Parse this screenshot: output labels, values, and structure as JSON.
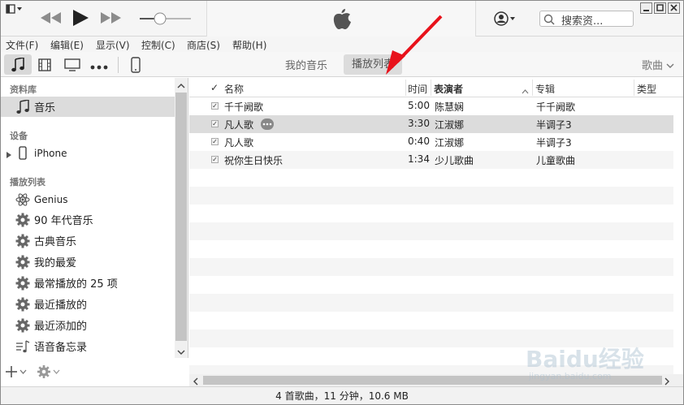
{
  "search": {
    "placeholder": "搜索资..."
  },
  "menu": [
    "文件(F)",
    "编辑(E)",
    "显示(V)",
    "控制(C)",
    "商店(S)",
    "帮助(H)"
  ],
  "toolbar": {
    "my_music": "我的音乐",
    "playlists": "播放列表",
    "view_label": "歌曲"
  },
  "sidebar": {
    "library_header": "资料库",
    "music": "音乐",
    "devices_header": "设备",
    "iphone": "iPhone",
    "playlists_header": "播放列表",
    "playlists": [
      "Genius",
      "90 年代音乐",
      "古典音乐",
      "我的最爱",
      "最常播放的 25 项",
      "最近播放的",
      "最近添加的",
      "语音备忘录"
    ]
  },
  "table": {
    "headers": {
      "check": "✓",
      "name": "名称",
      "time": "时间",
      "artist": "表演者",
      "album": "专辑",
      "genre": "类型"
    },
    "rows": [
      {
        "name": "千千阙歌",
        "time": "5:00",
        "artist": "陈慧娴",
        "album": "千千阙歌"
      },
      {
        "name": "凡人歌",
        "time": "3:30",
        "artist": "江淑娜",
        "album": "半调子3"
      },
      {
        "name": "凡人歌",
        "time": "0:40",
        "artist": "江淑娜",
        "album": "半调子3"
      },
      {
        "name": "祝你生日快乐",
        "time": "1:34",
        "artist": "少儿歌曲",
        "album": "儿童歌曲"
      }
    ]
  },
  "status": "4 首歌曲，11 分钟，10.6 MB",
  "watermark": {
    "brand": "Baidu经验",
    "url": "jingyan.baidu.com"
  }
}
